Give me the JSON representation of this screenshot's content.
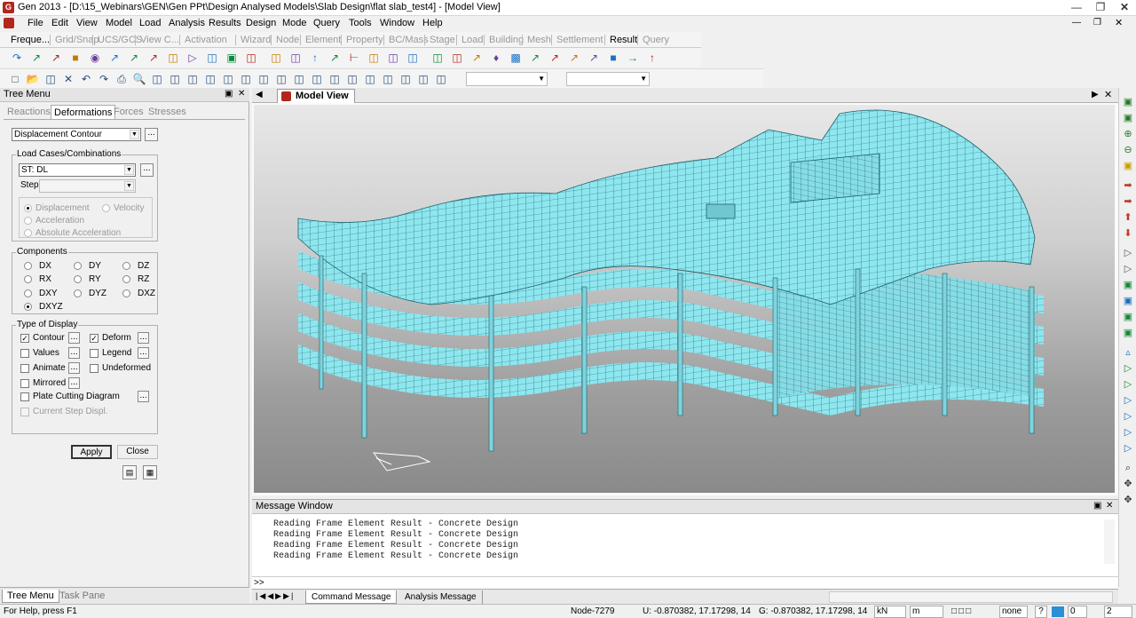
{
  "window": {
    "title": "Gen 2013 - [D:\\15_Webinars\\GEN\\Gen PPt\\Design Analysed Models\\Slab Design\\flat slab_test4] - [Model View]"
  },
  "menu": [
    "File",
    "Edit",
    "View",
    "Model",
    "Load",
    "Analysis",
    "Results",
    "Design",
    "Mode",
    "Query",
    "Tools",
    "Window",
    "Help"
  ],
  "ribbon_tabs": [
    "Freque...",
    "Grid/Snap",
    "UCS/GCS",
    "View C...",
    "Activation",
    "Wizard",
    "Node",
    "Element",
    "Property",
    "BC/Mass",
    "Stage",
    "Load",
    "Building",
    "Mesh",
    "Settlement",
    "Result",
    "Query"
  ],
  "tree_menu": {
    "title": "Tree Menu",
    "pin": "ᵖ",
    "close": "×",
    "tabs": [
      "Reactions",
      "Deformations",
      "Forces",
      "Stresses"
    ],
    "result_type": "Displacement Contour",
    "load_cases_label": "Load Cases/Combinations",
    "load_case": "ST: DL",
    "step_label": "Step",
    "modes": [
      "Displacement",
      "Velocity",
      "Acceleration",
      "Absolute Acceleration"
    ],
    "components_label": "Components",
    "components": [
      "DX",
      "DY",
      "DZ",
      "RX",
      "RY",
      "RZ",
      "DXY",
      "DYZ",
      "DXZ",
      "DXYZ"
    ],
    "selected_component": "DXYZ",
    "display_label": "Type of Display",
    "display": [
      {
        "label": "Contour",
        "checked": true
      },
      {
        "label": "Deform",
        "checked": true
      },
      {
        "label": "Values",
        "checked": false
      },
      {
        "label": "Legend",
        "checked": false
      },
      {
        "label": "Animate",
        "checked": false
      },
      {
        "label": "Undeformed",
        "checked": false
      },
      {
        "label": "Mirrored",
        "checked": false
      },
      {
        "label": "Plate Cutting Diagram",
        "checked": false
      },
      {
        "label": "Current Step Displ.",
        "checked": false
      }
    ],
    "apply": "Apply",
    "close_btn": "Close",
    "bottom_tabs": [
      "Tree Menu",
      "Task Pane"
    ]
  },
  "model_view": {
    "tab": "Model View",
    "mesh_color": "#8ee6ee",
    "line_color": "#1c5f6a"
  },
  "message_window": {
    "title": "Message Window",
    "lines": [
      "Reading Frame Element Result - Concrete Design",
      "Reading Frame Element Result - Concrete Design",
      "Reading Frame Element Result - Concrete Design",
      "Reading Frame Element Result - Concrete Design"
    ],
    "prompt": ">>",
    "tabs": [
      "Command Message",
      "Analysis Message"
    ]
  },
  "status": {
    "help": "For Help, press F1",
    "node": "Node-7279",
    "u": "U: -0.870382, 17.17298, 14",
    "g": "G: -0.870382, 17.17298, 14",
    "force_unit": "kN",
    "length_unit": "m",
    "none": "none",
    "q": "?",
    "zero": "0",
    "page": "2"
  }
}
